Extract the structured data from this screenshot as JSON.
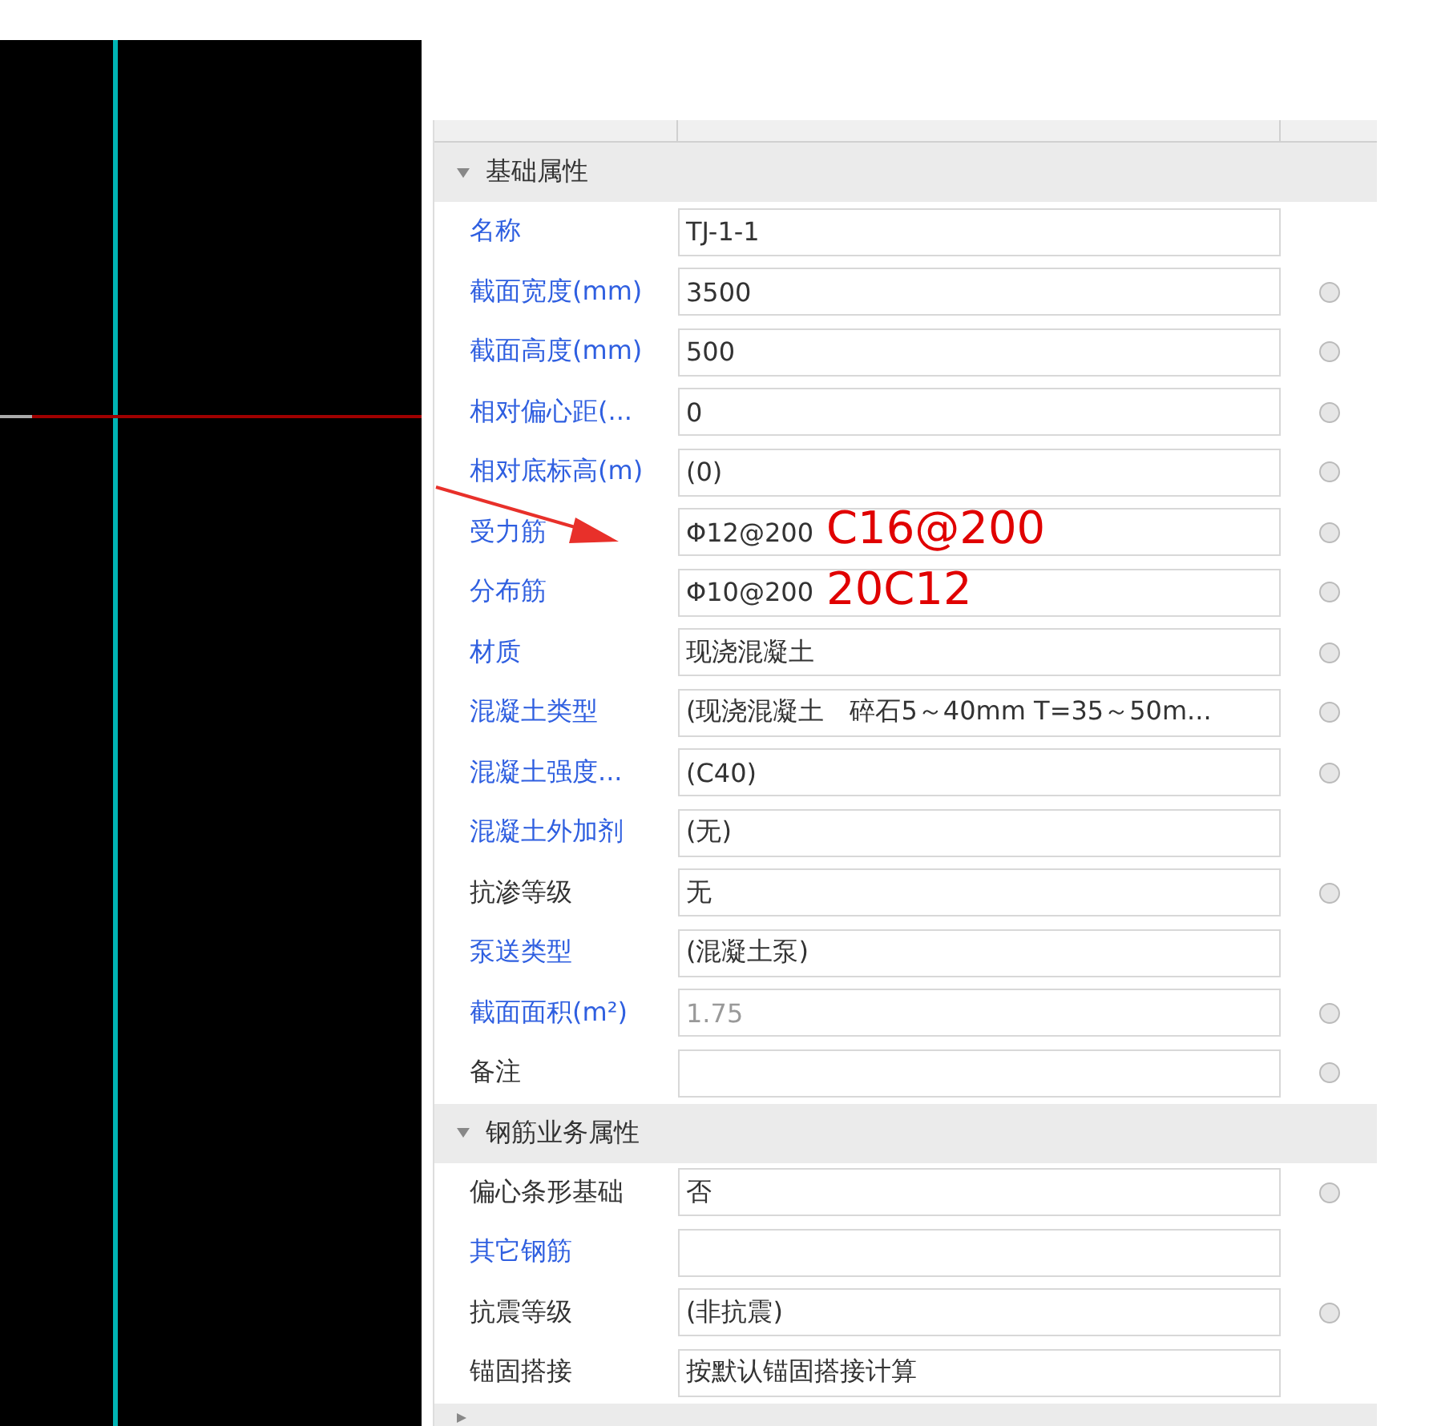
{
  "sections": [
    {
      "title": "基础属性",
      "expanded": true,
      "rows": [
        {
          "label": "名称",
          "public": true,
          "value": "TJ-1-1",
          "disabled": false,
          "dot": false
        },
        {
          "label": "截面宽度(mm)",
          "public": true,
          "value": "3500",
          "disabled": false,
          "dot": true
        },
        {
          "label": "截面高度(mm)",
          "public": true,
          "value": "500",
          "disabled": false,
          "dot": true
        },
        {
          "label": "相对偏心距(...",
          "public": true,
          "value": "0",
          "disabled": false,
          "dot": true
        },
        {
          "label": "相对底标高(m)",
          "public": true,
          "value": "(0)",
          "disabled": false,
          "dot": true
        },
        {
          "label": "受力筋",
          "public": true,
          "value": "Φ12@200",
          "disabled": false,
          "dot": true,
          "annotation": "C16@200"
        },
        {
          "label": "分布筋",
          "public": true,
          "value": "Φ10@200",
          "disabled": false,
          "dot": true,
          "annotation": "20C12"
        },
        {
          "label": "材质",
          "public": true,
          "value": "现浇混凝土",
          "disabled": false,
          "dot": true
        },
        {
          "label": "混凝土类型",
          "public": true,
          "value": "(现浇混凝土　碎石5～40mm  T=35～50m...",
          "disabled": false,
          "dot": true
        },
        {
          "label": "混凝土强度...",
          "public": true,
          "value": "(C40)",
          "disabled": false,
          "dot": true
        },
        {
          "label": "混凝土外加剂",
          "public": true,
          "value": "(无)",
          "disabled": false,
          "dot": false
        },
        {
          "label": "抗渗等级",
          "public": false,
          "value": "无",
          "disabled": false,
          "dot": true
        },
        {
          "label": "泵送类型",
          "public": true,
          "value": "(混凝土泵)",
          "disabled": false,
          "dot": false
        },
        {
          "label": "截面面积(m²)",
          "public": true,
          "value": "1.75",
          "disabled": true,
          "dot": true
        },
        {
          "label": "备注",
          "public": false,
          "value": "",
          "disabled": false,
          "dot": true
        }
      ]
    },
    {
      "title": "钢筋业务属性",
      "expanded": true,
      "rows": [
        {
          "label": "偏心条形基础",
          "public": false,
          "value": "否",
          "disabled": false,
          "dot": true
        },
        {
          "label": "其它钢筋",
          "public": true,
          "value": "",
          "disabled": false,
          "dot": false
        },
        {
          "label": "抗震等级",
          "public": false,
          "value": "(非抗震)",
          "disabled": false,
          "dot": true
        },
        {
          "label": "锚固搭接",
          "public": false,
          "value": "按默认锚固搭接计算",
          "disabled": false,
          "dot": false
        }
      ]
    },
    {
      "expanded": false
    }
  ]
}
